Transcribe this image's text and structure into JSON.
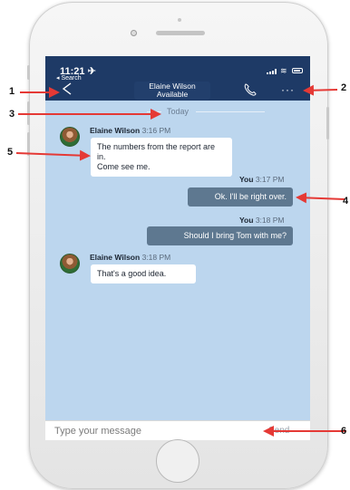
{
  "status": {
    "time": "11:21 ✈",
    "back_label": "◂ Search"
  },
  "header": {
    "contact_name": "Elaine Wilson",
    "contact_status": "Available",
    "more_label": "···"
  },
  "day_separator": "Today",
  "messages": [
    {
      "sender": "Elaine Wilson",
      "time": "3:16 PM",
      "text_line1": "The numbers from the report are in.",
      "text_line2": "Come see me."
    },
    {
      "sender": "You",
      "time": "3:17 PM",
      "text": "Ok. I'll be right over."
    },
    {
      "sender": "You",
      "time": "3:18 PM",
      "text": "Should I bring Tom with me?"
    },
    {
      "sender": "Elaine Wilson",
      "time": "3:18 PM",
      "text": "That's a good idea."
    }
  ],
  "composer": {
    "placeholder": "Type your message",
    "send_label": "Send"
  },
  "callouts": [
    "1",
    "2",
    "3",
    "4",
    "5",
    "6"
  ],
  "colors": {
    "navbar": "#1e3a66",
    "chat_background": "#bcd6ee",
    "outgoing_bubble": "#5e7890",
    "callout_arrow": "#e53935"
  }
}
